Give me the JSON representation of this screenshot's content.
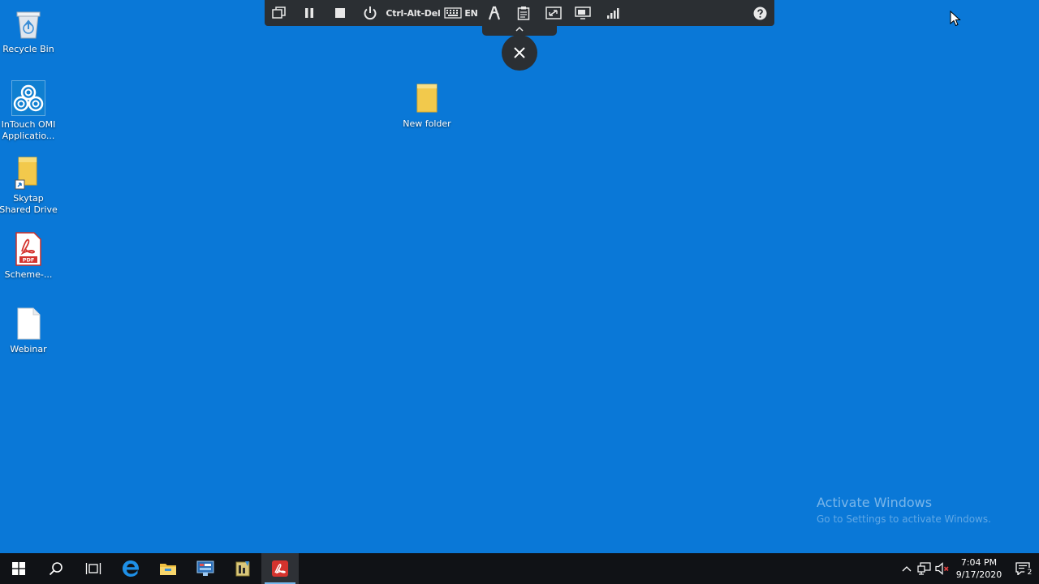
{
  "desktop": {
    "icons": [
      {
        "label": "Recycle Bin",
        "icon": "recycle-bin-icon"
      },
      {
        "label": "InTouch OMI Applicatio...",
        "icon": "intouch-omi-icon"
      },
      {
        "label": "Skytap Shared Drive",
        "icon": "shared-drive-folder-icon"
      },
      {
        "label": "Scheme-...",
        "icon": "pdf-file-icon"
      },
      {
        "label": "Webinar",
        "icon": "blank-file-icon"
      },
      {
        "label": "New folder",
        "icon": "folder-icon"
      }
    ]
  },
  "remote_toolbar": {
    "ctrl_alt_del": "Ctrl-Alt-Del",
    "keyboard_lang": "EN",
    "buttons": [
      "windows-icon",
      "pause-icon",
      "stop-icon",
      "power-icon",
      "keyboard-icon",
      "accessibility-icon",
      "clipboard-icon",
      "resize-icon",
      "display-icon",
      "signal-icon",
      "help-icon"
    ]
  },
  "watermark": {
    "title": "Activate Windows",
    "subtitle": "Go to Settings to activate Windows."
  },
  "taskbar": {
    "apps": [
      "start-icon",
      "search-icon",
      "task-view-icon",
      "edge-icon",
      "file-explorer-icon",
      "server-manager-icon",
      "app-icon",
      "acrobat-icon"
    ],
    "clock_time": "7:04 PM",
    "clock_date": "9/17/2020",
    "notification_count": "2"
  },
  "colors": {
    "desktop": "#0a78d7",
    "taskbar": "#101216",
    "toolbar": "#2b2f33"
  }
}
